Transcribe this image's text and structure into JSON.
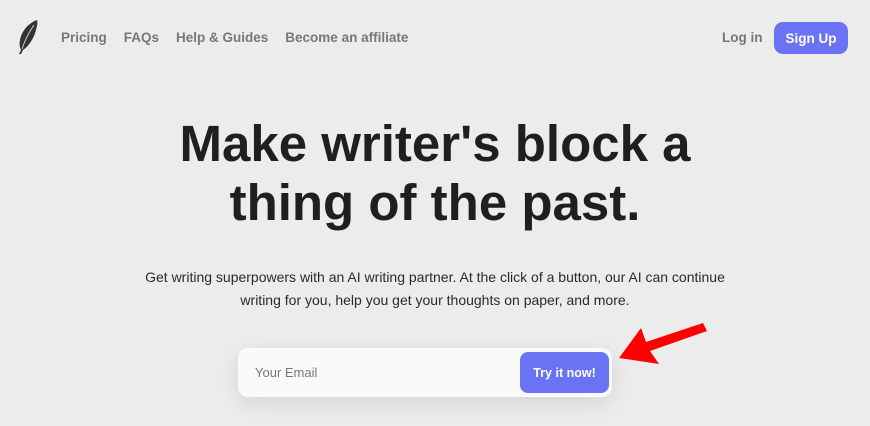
{
  "nav": {
    "links": [
      "Pricing",
      "FAQs",
      "Help & Guides",
      "Become an affiliate"
    ],
    "login": "Log in",
    "signup": "Sign Up"
  },
  "hero": {
    "headline_line1": "Make writer's block a",
    "headline_line2": "thing of the past.",
    "subtitle_line1": "Get writing superpowers with an AI writing partner. At the click of a button, our AI can continue",
    "subtitle_line2": "writing for you, help you get your thoughts on paper, and more."
  },
  "form": {
    "email_placeholder": "Your Email",
    "email_value": "",
    "cta": "Try it now!"
  },
  "colors": {
    "accent": "#6a73f4",
    "background": "#ececec",
    "annotation": "#ff0000"
  },
  "icons": {
    "logo": "feather-icon",
    "annotation": "red-arrow-icon"
  }
}
